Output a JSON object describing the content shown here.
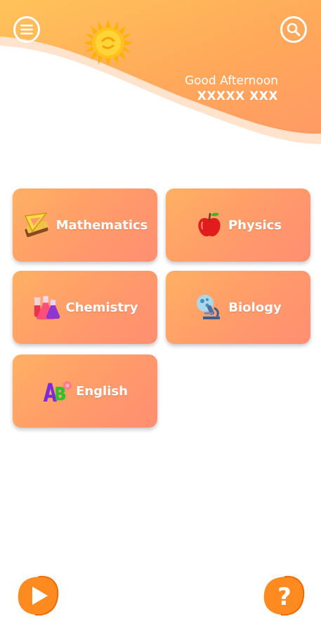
{
  "header": {
    "greeting": "Good Afternoon",
    "user_name": "XXXXX XXX",
    "menu_icon": "hamburger-menu-icon",
    "search_icon": "search-icon",
    "logo_icon": "sun-icon"
  },
  "subjects": [
    {
      "label": "Mathematics",
      "icon": "ruler-book-icon"
    },
    {
      "label": "Physics",
      "icon": "apple-icon"
    },
    {
      "label": "Chemistry",
      "icon": "flasks-icon"
    },
    {
      "label": "Biology",
      "icon": "microscope-icon"
    },
    {
      "label": "English",
      "icon": "abc-letters-icon"
    }
  ],
  "footer": {
    "play_icon": "play-icon",
    "help_icon": "question-mark-icon"
  },
  "colors": {
    "accent_orange": "#ff9a4a",
    "card_gradient_start": "#ffb063",
    "card_gradient_end": "#ff8e72"
  }
}
